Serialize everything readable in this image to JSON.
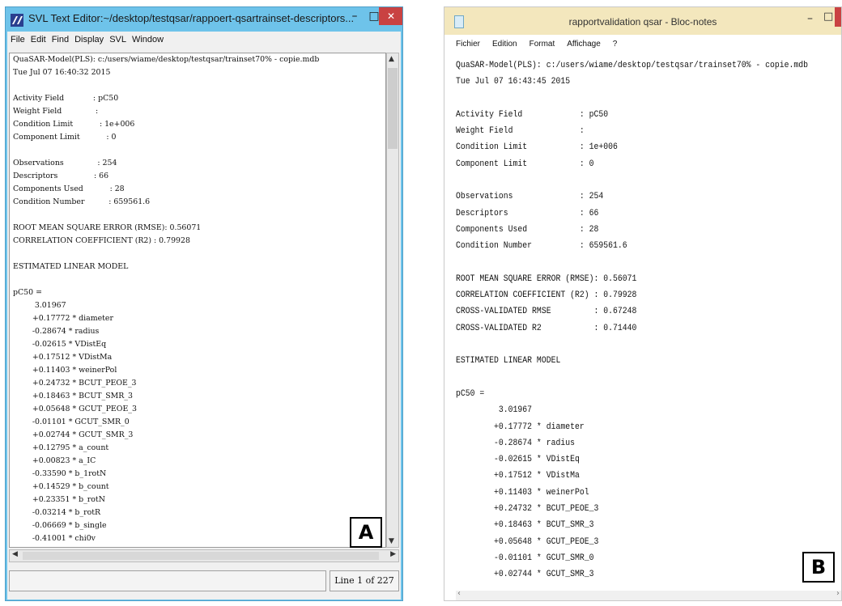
{
  "window_a": {
    "title": "SVL Text Editor:~/desktop/testqsar/rappoert-qsartrainset-descriptors...",
    "controls": {
      "minimize": "–",
      "maximize": "□",
      "close": "✕"
    },
    "menu": [
      "File",
      "Edit",
      "Find",
      "Display",
      "SVL",
      "Window"
    ],
    "lines": [
      "QuaSAR-Model(PLS): c:/users/wiame/desktop/testqsar/trainset70% - copie.mdb",
      "Tue Jul 07 16:40:32 2015",
      "",
      "Activity Field            : pC50",
      "Weight Field              :",
      "Condition Limit           : 1e+006",
      "Component Limit           : 0",
      "",
      "Observations              : 254",
      "Descriptors               : 66",
      "Components Used           : 28",
      "Condition Number          : 659561.6",
      "",
      "ROOT MEAN SQUARE ERROR (RMSE): 0.56071",
      "CORRELATION COEFFICIENT (R2) : 0.79928",
      "",
      "ESTIMATED LINEAR MODEL",
      "",
      "pC50 =",
      "         3.01967",
      "        +0.17772 * diameter",
      "        -0.28674 * radius",
      "        -0.02615 * VDistEq",
      "        +0.17512 * VDistMa",
      "        +0.11403 * weinerPol",
      "        +0.24732 * BCUT_PEOE_3",
      "        +0.18463 * BCUT_SMR_3",
      "        +0.05648 * GCUT_PEOE_3",
      "        -0.01101 * GCUT_SMR_0",
      "        +0.02744 * GCUT_SMR_3",
      "        +0.12795 * a_count",
      "        +0.00823 * a_IC",
      "        -0.33590 * b_1rotN",
      "        +0.14529 * b_count",
      "        +0.23351 * b_rotN",
      "        -0.03214 * b_rotR",
      "        -0.06669 * b_single",
      "        -0.41001 * chi0v"
    ],
    "status_right": "Line 1 of 227",
    "panel_label": "A"
  },
  "window_b": {
    "title": "rapportvalidation qsar - Bloc-notes",
    "controls": {
      "minimize": "–",
      "maximize": "□"
    },
    "menu": [
      "Fichier",
      "Edition",
      "Format",
      "Affichage",
      "?"
    ],
    "lines": [
      "QuaSAR-Model(PLS): c:/users/wiame/desktop/testqsar/trainset70% - copie.mdb",
      "Tue Jul 07 16:43:45 2015",
      "",
      "Activity Field            : pC50",
      "Weight Field              :",
      "Condition Limit           : 1e+006",
      "Component Limit           : 0",
      "",
      "Observations              : 254",
      "Descriptors               : 66",
      "Components Used           : 28",
      "Condition Number          : 659561.6",
      "",
      "ROOT MEAN SQUARE ERROR (RMSE): 0.56071",
      "CORRELATION COEFFICIENT (R2) : 0.79928",
      "CROSS-VALIDATED RMSE         : 0.67248",
      "CROSS-VALIDATED R2           : 0.71440",
      "",
      "ESTIMATED LINEAR MODEL",
      "",
      "pC50 =",
      "         3.01967",
      "        +0.17772 * diameter",
      "        -0.28674 * radius",
      "        -0.02615 * VDistEq",
      "        +0.17512 * VDistMa",
      "        +0.11403 * weinerPol",
      "        +0.24732 * BCUT_PEOE_3",
      "        +0.18463 * BCUT_SMR_3",
      "        +0.05648 * GCUT_PEOE_3",
      "        -0.01101 * GCUT_SMR_0",
      "        +0.02744 * GCUT_SMR_3"
    ],
    "panel_label": "B"
  },
  "colors": {
    "svl_titlebar": "#6ec3ea",
    "notepad_titlebar": "#f3e7bd",
    "close_button": "#c94242"
  }
}
